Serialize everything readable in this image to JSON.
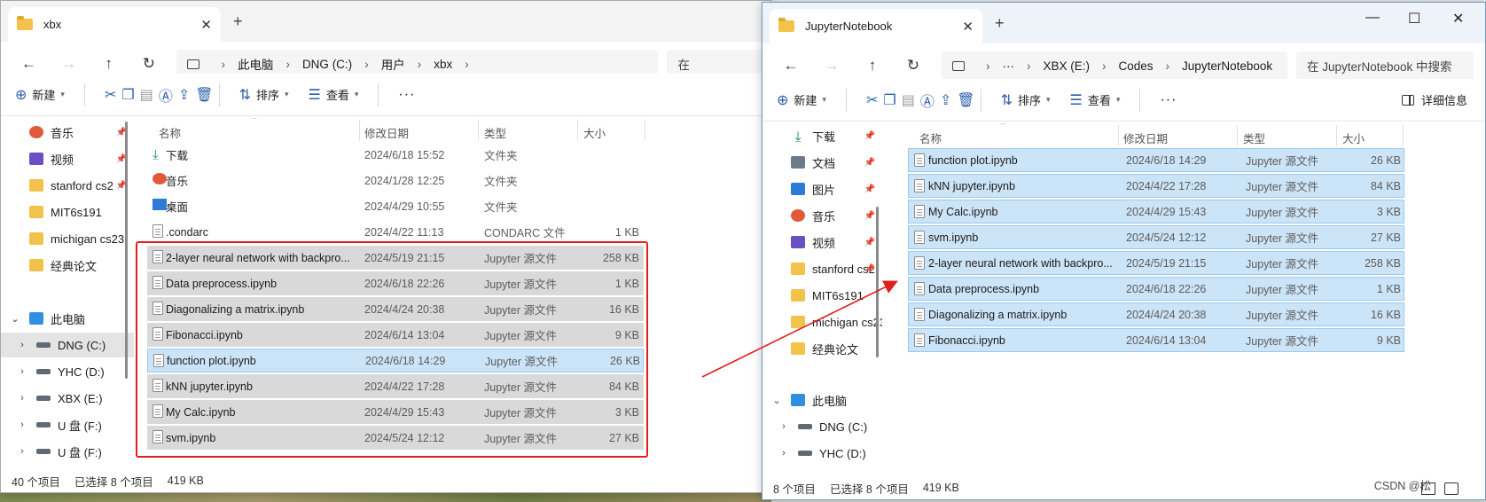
{
  "left_window": {
    "tab_title": "xbx",
    "breadcrumbs": [
      "此电脑",
      "DNG (C:)",
      "用户",
      "xbx"
    ],
    "search_text": "在",
    "toolbar": {
      "new_label": "新建",
      "sort_label": "排序",
      "view_label": "查看",
      "more_label": "···"
    },
    "columns": {
      "name": "名称",
      "date": "修改日期",
      "type": "类型",
      "size": "大小"
    },
    "nav_items": [
      {
        "label": "音乐",
        "icon": "music-icon",
        "pinned": true
      },
      {
        "label": "视频",
        "icon": "video-icon",
        "pinned": true
      },
      {
        "label": "stanford cs2",
        "icon": "folder-icon",
        "pinned": true
      },
      {
        "label": "MIT6s191",
        "icon": "folder-icon",
        "pinned": false
      },
      {
        "label": "michigan cs23",
        "icon": "folder-icon",
        "pinned": false
      },
      {
        "label": "经典论文",
        "icon": "folder-icon",
        "pinned": false
      },
      {
        "label": "此电脑",
        "icon": "pc-icon",
        "pinned": false
      },
      {
        "label": "DNG (C:)",
        "icon": "drive-icon",
        "pinned": false
      },
      {
        "label": "YHC (D:)",
        "icon": "drive-icon",
        "pinned": false
      },
      {
        "label": "XBX (E:)",
        "icon": "drive-icon",
        "pinned": false
      },
      {
        "label": "U 盘 (F:)",
        "icon": "drive-icon",
        "pinned": false
      },
      {
        "label": "U 盘 (F:)",
        "icon": "drive-icon",
        "pinned": false
      }
    ],
    "files": [
      {
        "name": "下载",
        "date": "2024/6/18 15:52",
        "type": "文件夹",
        "size": "",
        "icon": "download-icon",
        "state": "none"
      },
      {
        "name": "音乐",
        "date": "2024/1/28 12:25",
        "type": "文件夹",
        "size": "",
        "icon": "music-icon",
        "state": "none"
      },
      {
        "name": "桌面",
        "date": "2024/4/29 10:55",
        "type": "文件夹",
        "size": "",
        "icon": "desktop-icon",
        "state": "none"
      },
      {
        "name": ".condarc",
        "date": "2024/4/22 11:13",
        "type": "CONDARC 文件",
        "size": "1 KB",
        "icon": "file-icon",
        "state": "none"
      },
      {
        "name": "2-layer neural network with backpro...",
        "date": "2024/5/19 21:15",
        "type": "Jupyter 源文件",
        "size": "258 KB",
        "icon": "file-icon",
        "state": "gray"
      },
      {
        "name": "Data preprocess.ipynb",
        "date": "2024/6/18 22:26",
        "type": "Jupyter 源文件",
        "size": "1 KB",
        "icon": "file-icon",
        "state": "gray"
      },
      {
        "name": "Diagonalizing a matrix.ipynb",
        "date": "2024/4/24 20:38",
        "type": "Jupyter 源文件",
        "size": "16 KB",
        "icon": "file-icon",
        "state": "gray"
      },
      {
        "name": "Fibonacci.ipynb",
        "date": "2024/6/14 13:04",
        "type": "Jupyter 源文件",
        "size": "9 KB",
        "icon": "file-icon",
        "state": "gray"
      },
      {
        "name": "function plot.ipynb",
        "date": "2024/6/18 14:29",
        "type": "Jupyter 源文件",
        "size": "26 KB",
        "icon": "file-icon",
        "state": "blue"
      },
      {
        "name": "kNN jupyter.ipynb",
        "date": "2024/4/22 17:28",
        "type": "Jupyter 源文件",
        "size": "84 KB",
        "icon": "file-icon",
        "state": "gray"
      },
      {
        "name": "My Calc.ipynb",
        "date": "2024/4/29 15:43",
        "type": "Jupyter 源文件",
        "size": "3 KB",
        "icon": "file-icon",
        "state": "gray"
      },
      {
        "name": "svm.ipynb",
        "date": "2024/5/24 12:12",
        "type": "Jupyter 源文件",
        "size": "27 KB",
        "icon": "file-icon",
        "state": "gray"
      }
    ],
    "status": {
      "count": "40 个项目",
      "selected": "已选择 8 个项目",
      "size": "419 KB"
    }
  },
  "right_window": {
    "tab_title": "JupyterNotebook",
    "breadcrumbs": [
      "···",
      "XBX (E:)",
      "Codes",
      "JupyterNotebook"
    ],
    "search_text": "在 JupyterNotebook 中搜索",
    "toolbar": {
      "new_label": "新建",
      "sort_label": "排序",
      "view_label": "查看",
      "more_label": "···",
      "details_label": "详细信息"
    },
    "columns": {
      "name": "名称",
      "date": "修改日期",
      "type": "类型",
      "size": "大小"
    },
    "nav_items": [
      {
        "label": "下载",
        "icon": "download-icon",
        "pinned": true
      },
      {
        "label": "文档",
        "icon": "document-icon",
        "pinned": true
      },
      {
        "label": "图片",
        "icon": "picture-icon",
        "pinned": true
      },
      {
        "label": "音乐",
        "icon": "music-icon",
        "pinned": true
      },
      {
        "label": "视频",
        "icon": "video-icon",
        "pinned": true
      },
      {
        "label": "stanford cs2",
        "icon": "folder-icon",
        "pinned": true
      },
      {
        "label": "MIT6s191",
        "icon": "folder-icon",
        "pinned": false
      },
      {
        "label": "michigan cs23",
        "icon": "folder-icon",
        "pinned": false
      },
      {
        "label": "经典论文",
        "icon": "folder-icon",
        "pinned": false
      },
      {
        "label": "此电脑",
        "icon": "pc-icon",
        "pinned": false
      },
      {
        "label": "DNG (C:)",
        "icon": "drive-icon",
        "pinned": false
      },
      {
        "label": "YHC (D:)",
        "icon": "drive-icon",
        "pinned": false
      }
    ],
    "files": [
      {
        "name": "function plot.ipynb",
        "date": "2024/6/18 14:29",
        "type": "Jupyter 源文件",
        "size": "26 KB"
      },
      {
        "name": "kNN jupyter.ipynb",
        "date": "2024/4/22 17:28",
        "type": "Jupyter 源文件",
        "size": "84 KB"
      },
      {
        "name": "My Calc.ipynb",
        "date": "2024/4/29 15:43",
        "type": "Jupyter 源文件",
        "size": "3 KB"
      },
      {
        "name": "svm.ipynb",
        "date": "2024/5/24 12:12",
        "type": "Jupyter 源文件",
        "size": "27 KB"
      },
      {
        "name": "2-layer neural network with backpro...",
        "date": "2024/5/19 21:15",
        "type": "Jupyter 源文件",
        "size": "258 KB"
      },
      {
        "name": "Data preprocess.ipynb",
        "date": "2024/6/18 22:26",
        "type": "Jupyter 源文件",
        "size": "1 KB"
      },
      {
        "name": "Diagonalizing a matrix.ipynb",
        "date": "2024/4/24 20:38",
        "type": "Jupyter 源文件",
        "size": "16 KB"
      },
      {
        "name": "Fibonacci.ipynb",
        "date": "2024/6/14 13:04",
        "type": "Jupyter 源文件",
        "size": "9 KB"
      }
    ],
    "status": {
      "count": "8 个项目",
      "selected": "已选择 8 个项目",
      "size": "419 KB"
    }
  },
  "watermark": "CSDN @松",
  "colors": {
    "annotation_red": "#e0201b",
    "selection_blue": "#cce4f7",
    "selection_gray": "#d9d9d9"
  }
}
